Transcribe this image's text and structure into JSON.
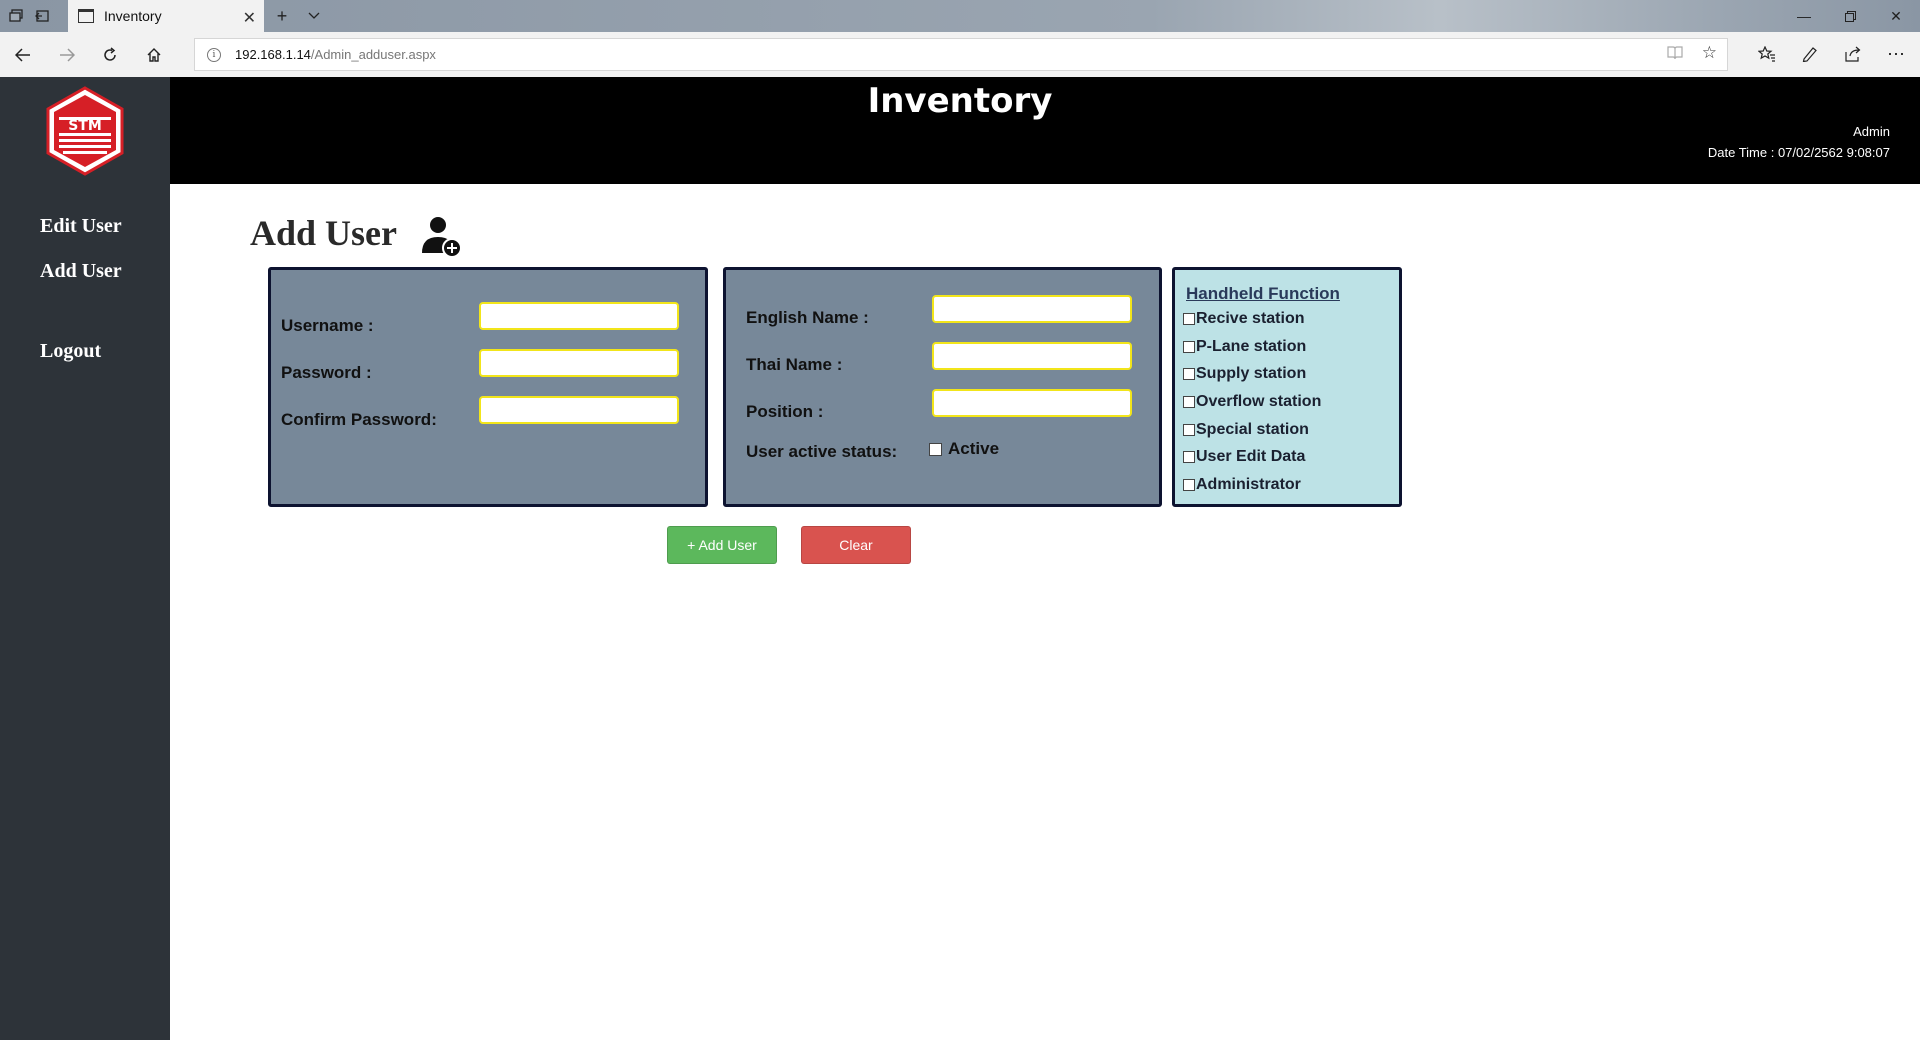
{
  "browser": {
    "tab_title": "Inventory",
    "url_host": "192.168.1.14",
    "url_path": "/Admin_adduser.aspx"
  },
  "header": {
    "logo_text": "STM",
    "title": "Inventory",
    "user": "Admin",
    "datetime": "Date Time : 07/02/2562 9:08:07"
  },
  "sidebar": {
    "items": [
      {
        "label": "Edit User"
      },
      {
        "label": "Add User"
      },
      {
        "label": "Logout"
      }
    ]
  },
  "page": {
    "title": "Add User"
  },
  "account_panel": {
    "username_label": "Username :",
    "password_label": "Password :",
    "confirm_label": "Confirm Password:",
    "username_value": "",
    "password_value": "",
    "confirm_value": ""
  },
  "profile_panel": {
    "english_name_label": "English Name :",
    "thai_name_label": "Thai Name :",
    "position_label": "Position :",
    "status_label": "User active status:",
    "active_label": "Active",
    "active_checked": false
  },
  "handheld": {
    "title": "Handheld Function",
    "items": [
      {
        "label": "Recive station",
        "checked": false
      },
      {
        "label": "P-Lane station",
        "checked": false
      },
      {
        "label": "Supply station",
        "checked": false
      },
      {
        "label": "Overflow station",
        "checked": false
      },
      {
        "label": "Special station",
        "checked": false
      },
      {
        "label": "User Edit Data",
        "checked": false
      },
      {
        "label": "Administrator",
        "checked": false
      }
    ]
  },
  "actions": {
    "add_label": "+ Add User",
    "clear_label": "Clear"
  },
  "colors": {
    "sidebar_bg": "#2d3339",
    "header_bg": "#000000",
    "panel_bg": "#778899",
    "handheld_bg": "#bde2e6",
    "add_button": "#5cb85c",
    "clear_button": "#d9534f",
    "input_border": "#f2e51a"
  }
}
